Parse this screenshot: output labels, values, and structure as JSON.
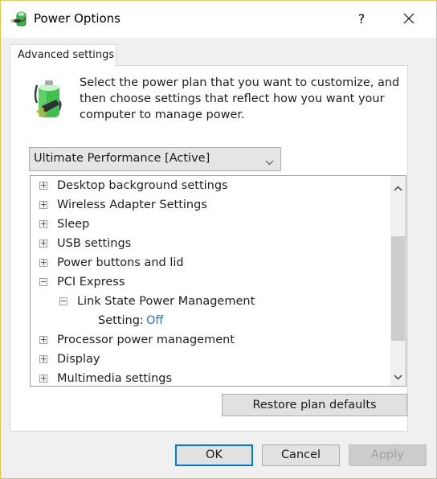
{
  "window": {
    "title": "Power Options",
    "help_glyph": "?",
    "icons": {
      "app": "power-plug-battery-icon",
      "close": "close-icon"
    }
  },
  "tabs": [
    {
      "label": "Advanced settings",
      "active": true
    }
  ],
  "description": {
    "icon": "battery-plug-icon",
    "text": "Select the power plan that you want to customize, and then choose settings that reflect how you want your computer to manage power."
  },
  "plan_select": {
    "selected": "Ultimate Performance [Active]",
    "icon": "chevron-down-icon"
  },
  "tree": {
    "items": [
      {
        "label": "Desktop background settings",
        "level": 0,
        "expander": "plus"
      },
      {
        "label": "Wireless Adapter Settings",
        "level": 0,
        "expander": "plus"
      },
      {
        "label": "Sleep",
        "level": 0,
        "expander": "plus"
      },
      {
        "label": "USB settings",
        "level": 0,
        "expander": "plus"
      },
      {
        "label": "Power buttons and lid",
        "level": 0,
        "expander": "plus"
      },
      {
        "label": "PCI Express",
        "level": 0,
        "expander": "minus"
      },
      {
        "label": "Link State Power Management",
        "level": 1,
        "expander": "minus"
      },
      {
        "label": "Setting:",
        "level": 2,
        "value": "Off"
      },
      {
        "label": "Processor power management",
        "level": 0,
        "expander": "plus"
      },
      {
        "label": "Display",
        "level": 0,
        "expander": "plus"
      },
      {
        "label": "Multimedia settings",
        "level": 0,
        "expander": "plus"
      }
    ],
    "scrollbar": {
      "up_icon": "chevron-up-icon",
      "down_icon": "chevron-down-icon"
    }
  },
  "buttons": {
    "restore": "Restore plan defaults",
    "ok": "OK",
    "cancel": "Cancel",
    "apply": "Apply"
  },
  "colors": {
    "window_border": "#f0c040",
    "focus_blue": "#0078d7",
    "setting_value": "#1e74d8"
  }
}
